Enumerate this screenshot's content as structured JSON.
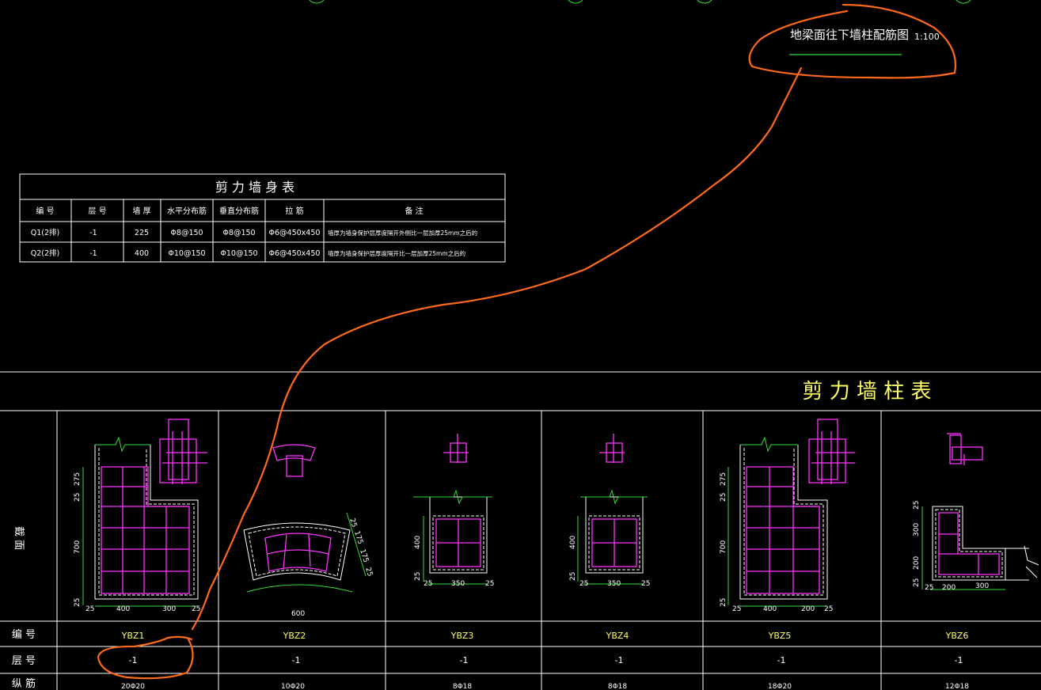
{
  "drawing": {
    "title": "地梁面往下墙柱配筋图",
    "scale": "1:100"
  },
  "wall_body_table": {
    "title": "剪 力 墙 身 表",
    "headers": [
      "编 号",
      "层 号",
      "墙 厚",
      "水平分布筋",
      "垂直分布筋",
      "拉 筋",
      "备 注"
    ],
    "rows": [
      [
        "Q1(2排)",
        "-1",
        "225",
        "Φ8@150",
        "Φ8@150",
        "Φ6@450x450",
        "墙厚为墙身保护层厚度隔开外侧比一层加厚25mm之后的"
      ],
      [
        "Q2(2排)",
        "-1",
        "400",
        "Φ10@150",
        "Φ10@150",
        "Φ6@450x450",
        "墙厚为墙身保护层厚度隔开比一层加厚25mm之后的"
      ]
    ]
  },
  "column_table": {
    "title": "剪 力 墙 柱 表",
    "row_labels": {
      "section": "截 面",
      "id": "编 号",
      "floor": "层 号",
      "bars": "纵 筋"
    },
    "columns": [
      {
        "id": "YBZ1",
        "floor": "-1",
        "bars": "20Φ20",
        "dims": {
          "h1": "25",
          "h2": "275",
          "h3": "25",
          "h4": "700",
          "h5": "25",
          "w1": "25",
          "w2": "400",
          "w3": "300",
          "w4": "25"
        }
      },
      {
        "id": "YBZ2",
        "floor": "-1",
        "bars": "10Φ20",
        "dims": {
          "r1": "25",
          "r2": "175",
          "r3": "175",
          "r4": "25",
          "w": "600"
        }
      },
      {
        "id": "YBZ3",
        "floor": "-1",
        "bars": "8Φ18",
        "dims": {
          "h1": "400",
          "h2": "25",
          "w1": "25",
          "w2": "350",
          "w3": "25"
        }
      },
      {
        "id": "YBZ4",
        "floor": "-1",
        "bars": "8Φ18",
        "dims": {
          "h1": "400",
          "h2": "25",
          "w1": "25",
          "w2": "350",
          "w3": "25"
        }
      },
      {
        "id": "YBZ5",
        "floor": "-1",
        "bars": "18Φ20",
        "dims": {
          "h1": "25",
          "h2": "275",
          "h3": "25",
          "h4": "700",
          "h5": "25",
          "w1": "25",
          "w2": "400",
          "w3": "200",
          "w4": "25"
        }
      },
      {
        "id": "YBZ6",
        "floor": "-1",
        "bars": "12Φ18",
        "dims": {
          "h1": "25",
          "h2": "300",
          "h3": "200",
          "h4": "25",
          "w1": "25",
          "w2": "200",
          "w3": "300"
        }
      }
    ]
  },
  "colors": {
    "background": "#000000",
    "lines": "#ffffff",
    "rebar": "#ff33ff",
    "dimension": "#33dd33",
    "title_text": "#ffff66",
    "markup": "#ff6a1a"
  }
}
